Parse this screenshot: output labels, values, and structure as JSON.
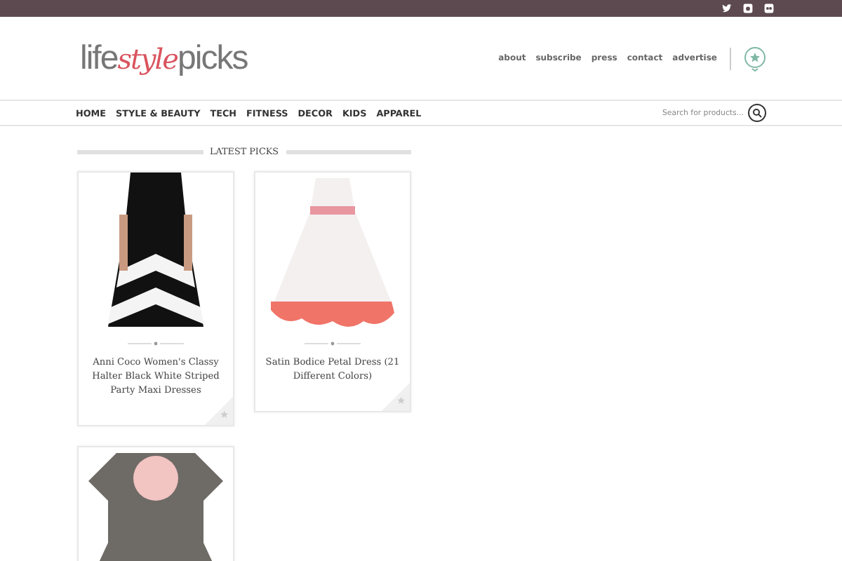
{
  "logo": {
    "parts": [
      {
        "text": "life",
        "color": "#777777"
      },
      {
        "text": "style",
        "color": "#d9545f"
      },
      {
        "text": "picks",
        "color": "#777777"
      }
    ]
  },
  "header_links": [
    "about",
    "subscribe",
    "press",
    "contact",
    "advertise"
  ],
  "nav": {
    "items": [
      "HOME",
      "STYLE & BEAUTY",
      "TECH",
      "FITNESS",
      "DECOR",
      "KIDS",
      "APPAREL"
    ],
    "search": {
      "placeholder": "Search for products..."
    }
  },
  "section_title": "LATEST PICKS",
  "products": [
    {
      "title": "Anni Coco Women's Classy Halter Black White Striped Party Maxi Dresses"
    },
    {
      "title": "Satin Bodice Petal Dress (21 Different Colors)"
    }
  ]
}
